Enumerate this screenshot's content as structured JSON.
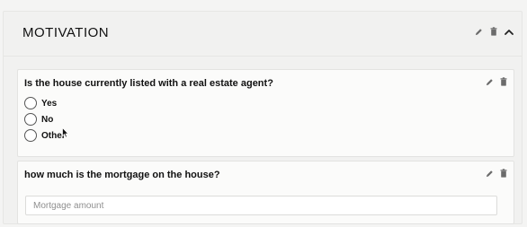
{
  "section": {
    "title": "MOTIVATION",
    "icons": [
      "pencil-icon",
      "trash-icon",
      "chevron-up-icon"
    ]
  },
  "questions": [
    {
      "title": "Is the house currently listed with a real estate agent?",
      "type": "radio",
      "options": [
        "Yes",
        "No",
        "Other"
      ],
      "icons": [
        "pencil-icon",
        "trash-icon"
      ]
    },
    {
      "title": "how much is the mortgage on the house?",
      "type": "text",
      "placeholder": "Mortgage amount",
      "value": "",
      "icons": [
        "pencil-icon",
        "trash-icon"
      ]
    }
  ],
  "colors": {
    "page_bg": "#f4f4f3",
    "section_bg": "#f1f1f0",
    "card_bg": "#fbfbfa",
    "border": "#e3e3e1",
    "text": "#111111",
    "icon": "#6b6b6b"
  }
}
